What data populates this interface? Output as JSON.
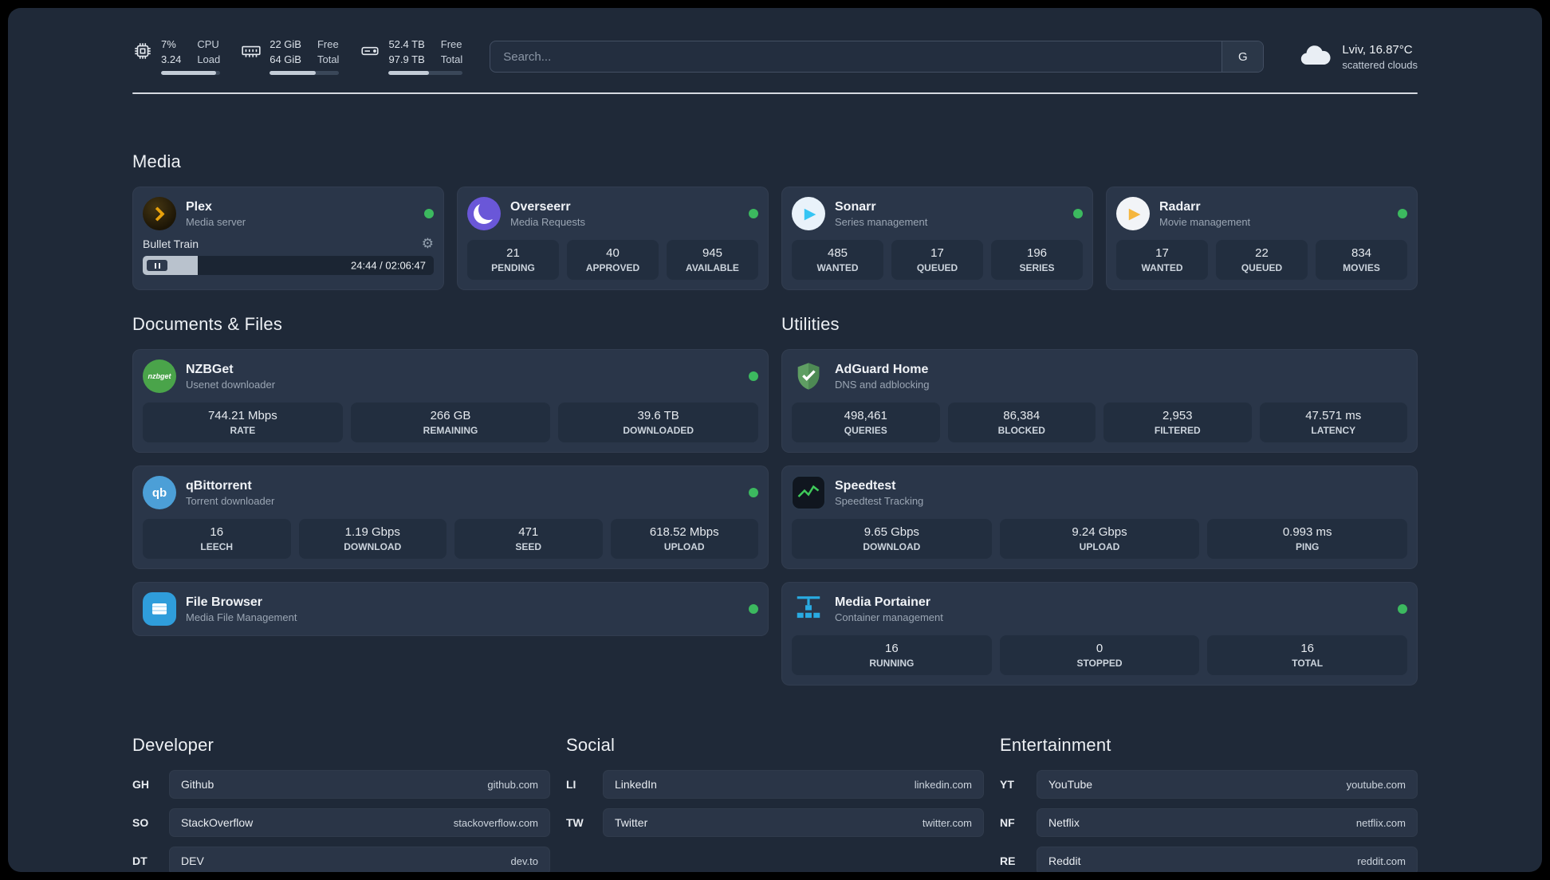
{
  "topbar": {
    "cpu": {
      "value_top": "7%",
      "value_bottom": "3.24",
      "label_top": "CPU",
      "label_bottom": "Load",
      "progress": 93
    },
    "ram": {
      "value_top": "22 GiB",
      "value_bottom": "64 GiB",
      "label_top": "Free",
      "label_bottom": "Total",
      "progress": 66
    },
    "disk": {
      "value_top": "52.4 TB",
      "value_bottom": "97.9 TB",
      "label_top": "Free",
      "label_bottom": "Total",
      "progress": 54
    },
    "search": {
      "placeholder": "Search...",
      "engine_label": "G"
    },
    "weather": {
      "location": "Lviv, 16.87°C",
      "condition": "scattered clouds"
    }
  },
  "sections": {
    "media": "Media",
    "documents": "Documents & Files",
    "utilities": "Utilities",
    "developer": "Developer",
    "social": "Social",
    "entertainment": "Entertainment"
  },
  "apps": {
    "plex": {
      "title": "Plex",
      "subtitle": "Media server",
      "player": {
        "track": "Bullet Train",
        "time": "24:44 / 02:06:47",
        "progress": 19
      }
    },
    "overseerr": {
      "title": "Overseerr",
      "subtitle": "Media Requests",
      "stats": [
        {
          "value": "21",
          "label": "PENDING"
        },
        {
          "value": "40",
          "label": "APPROVED"
        },
        {
          "value": "945",
          "label": "AVAILABLE"
        }
      ]
    },
    "sonarr": {
      "title": "Sonarr",
      "subtitle": "Series management",
      "icon_glyph": "▶",
      "stats": [
        {
          "value": "485",
          "label": "WANTED"
        },
        {
          "value": "17",
          "label": "QUEUED"
        },
        {
          "value": "196",
          "label": "SERIES"
        }
      ]
    },
    "radarr": {
      "title": "Radarr",
      "subtitle": "Movie management",
      "icon_glyph": "▶",
      "stats": [
        {
          "value": "17",
          "label": "WANTED"
        },
        {
          "value": "22",
          "label": "QUEUED"
        },
        {
          "value": "834",
          "label": "MOVIES"
        }
      ]
    },
    "nzbget": {
      "title": "NZBGet",
      "subtitle": "Usenet downloader",
      "icon_text": "nzbget",
      "stats": [
        {
          "value": "744.21 Mbps",
          "label": "RATE"
        },
        {
          "value": "266 GB",
          "label": "REMAINING"
        },
        {
          "value": "39.6 TB",
          "label": "DOWNLOADED"
        }
      ]
    },
    "qbittorrent": {
      "title": "qBittorrent",
      "subtitle": "Torrent downloader",
      "icon_text": "qb",
      "stats": [
        {
          "value": "16",
          "label": "LEECH"
        },
        {
          "value": "1.19 Gbps",
          "label": "DOWNLOAD"
        },
        {
          "value": "471",
          "label": "SEED"
        },
        {
          "value": "618.52 Mbps",
          "label": "UPLOAD"
        }
      ]
    },
    "filebrowser": {
      "title": "File Browser",
      "subtitle": "Media File Management"
    },
    "adguard": {
      "title": "AdGuard Home",
      "subtitle": "DNS and adblocking",
      "stats": [
        {
          "value": "498,461",
          "label": "QUERIES"
        },
        {
          "value": "86,384",
          "label": "BLOCKED"
        },
        {
          "value": "2,953",
          "label": "FILTERED"
        },
        {
          "value": "47.571 ms",
          "label": "LATENCY"
        }
      ]
    },
    "speedtest": {
      "title": "Speedtest",
      "subtitle": "Speedtest Tracking",
      "stats": [
        {
          "value": "9.65 Gbps",
          "label": "DOWNLOAD"
        },
        {
          "value": "9.24 Gbps",
          "label": "UPLOAD"
        },
        {
          "value": "0.993 ms",
          "label": "PING"
        }
      ]
    },
    "portainer": {
      "title": "Media Portainer",
      "subtitle": "Container management",
      "stats": [
        {
          "value": "16",
          "label": "RUNNING"
        },
        {
          "value": "0",
          "label": "STOPPED"
        },
        {
          "value": "16",
          "label": "TOTAL"
        }
      ]
    }
  },
  "bookmarks": {
    "developer": [
      {
        "abbr": "GH",
        "name": "Github",
        "url": "github.com"
      },
      {
        "abbr": "SO",
        "name": "StackOverflow",
        "url": "stackoverflow.com"
      },
      {
        "abbr": "DT",
        "name": "DEV",
        "url": "dev.to"
      }
    ],
    "social": [
      {
        "abbr": "LI",
        "name": "LinkedIn",
        "url": "linkedin.com"
      },
      {
        "abbr": "TW",
        "name": "Twitter",
        "url": "twitter.com"
      }
    ],
    "entertainment": [
      {
        "abbr": "YT",
        "name": "YouTube",
        "url": "youtube.com"
      },
      {
        "abbr": "NF",
        "name": "Netflix",
        "url": "netflix.com"
      },
      {
        "abbr": "RE",
        "name": "Reddit",
        "url": "reddit.com"
      }
    ]
  },
  "colors": {
    "status_online_green": "#3cb95f",
    "plex_amber": "#e8a10b",
    "sonarr_blue": "#35c5f4",
    "radarr_yellow": "#f5b63e",
    "portainer_blue": "#29abe2",
    "adguard_green": "#5f9e63",
    "speedtest_green": "#3fca5a"
  }
}
